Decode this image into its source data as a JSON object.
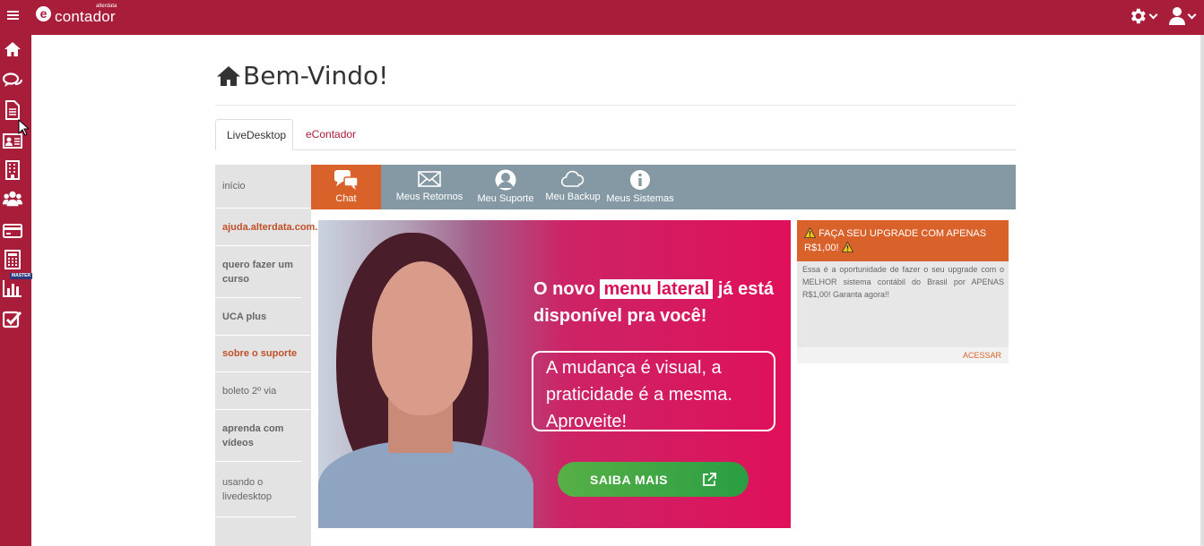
{
  "app": {
    "logo_text": "contador",
    "logo_letter": "e",
    "logo_superscript": "alterdata",
    "brand_color": "#a81e3a",
    "accent_color": "#d9622b"
  },
  "header": {
    "menu_icon": "hamburger-icon",
    "settings_icon": "gear-icon",
    "user_icon": "user-icon"
  },
  "left_rail": {
    "icons": [
      "home-icon",
      "chat-icon",
      "document-icon",
      "contact-card-icon",
      "building-icon",
      "users-icon",
      "credit-card-icon",
      "calculator-icon",
      "bar-chart-icon",
      "checklist-icon"
    ],
    "master_badge": "MASTER"
  },
  "page": {
    "title": "Bem-Vindo!"
  },
  "tabs": [
    {
      "label": "LiveDesktop",
      "active": true
    },
    {
      "label": "eContador",
      "active": false
    }
  ],
  "side_menu": [
    {
      "label": "início"
    },
    {
      "label": "ajuda.alterdata.com."
    },
    {
      "label": "quero fazer um curso"
    },
    {
      "label": "UCA plus"
    },
    {
      "label": "sobre o suporte"
    },
    {
      "label": "boleto 2º via"
    },
    {
      "label": "aprenda com vídeos"
    },
    {
      "label": "usando o livedesktop"
    }
  ],
  "icon_bar": [
    {
      "label": "Chat",
      "icon": "chat-bubbles-icon",
      "active": true
    },
    {
      "label": "Meus Retornos",
      "icon": "envelope-icon"
    },
    {
      "label": "Meu Suporte",
      "icon": "support-person-icon"
    },
    {
      "label": "Meu Backup",
      "icon": "cloud-icon"
    },
    {
      "label": "Meus Sistemas",
      "icon": "info-icon"
    }
  ],
  "banner": {
    "headline_pre": "O novo",
    "headline_highlight": "menu lateral",
    "headline_post": "já está disponível pra você!",
    "box_line1": "A mudança é visual, a",
    "box_line2": "praticidade é a mesma.",
    "box_line3": "Aproveite!",
    "button_label": "SAIBA MAIS"
  },
  "upgrade_card": {
    "title": "FAÇA SEU UPGRADE COM APENAS R$1,00!",
    "text": "Essa é a oportunidade de fazer o seu upgrade com o MELHOR sistema contábil do Brasil por APENAS R$1,00! Garanta agora!!",
    "link_label": "ACESSAR"
  }
}
